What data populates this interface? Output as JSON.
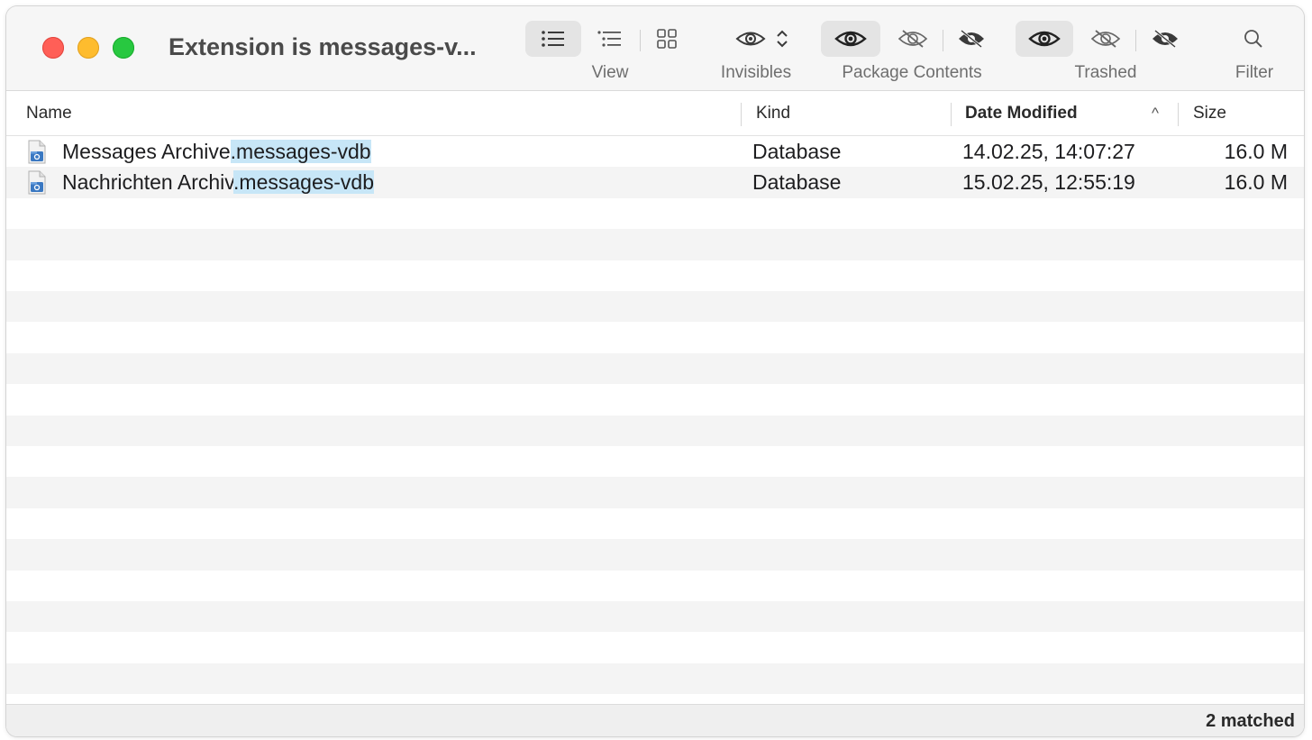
{
  "window": {
    "title": "Extension is messages-v..."
  },
  "toolbar": {
    "view_label": "View",
    "invisibles_label": "Invisibles",
    "package_contents_label": "Package Contents",
    "trashed_label": "Trashed",
    "filter_label": "Filter",
    "icons": {
      "view": [
        "list-view-icon",
        "outline-view-icon",
        "grid-view-icon"
      ],
      "invisibles": [
        "eye-icon",
        "up-down-chevron-icon"
      ],
      "package_contents": [
        "eye-icon",
        "eye-slash-icon",
        "eye-slash-filled-icon"
      ],
      "trashed": [
        "eye-icon",
        "eye-slash-icon",
        "eye-slash-filled-icon"
      ],
      "filter": "magnifier-icon"
    }
  },
  "columns": {
    "name": "Name",
    "kind": "Kind",
    "date_modified": "Date Modified",
    "sort_indicator": "^",
    "size": "Size"
  },
  "files": [
    {
      "name_base": "Messages Archive",
      "name_ext": ".messages-vdb",
      "kind": "Database",
      "date_modified": "14.02.25, 14:07:27",
      "size": "16.0 M"
    },
    {
      "name_base": "Nachrichten Archiv",
      "name_ext": ".messages-vdb",
      "kind": "Database",
      "date_modified": "15.02.25, 12:55:19",
      "size": "16.0 M"
    }
  ],
  "status": {
    "matched": "2 matched"
  },
  "colors": {
    "highlight": "#c7e6f7",
    "close": "#ff5f57",
    "minimize": "#febc2e",
    "zoom": "#28c840",
    "icon_blue": "#3a78c2"
  }
}
